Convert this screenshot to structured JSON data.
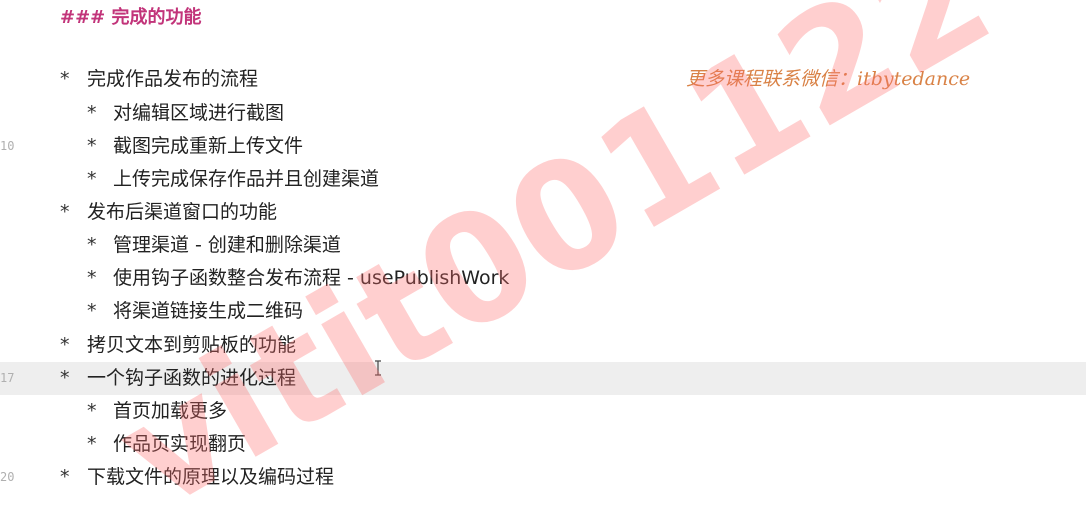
{
  "heading": "### 完成的功能",
  "promo": "更多课程联系微信：itbytedance",
  "watermark": "vitit001122",
  "colors": {
    "heading": "#c2347a",
    "promo": "#d98246",
    "watermark": "#ff6e6e",
    "current_line": "#eeeeee"
  },
  "lines": [
    {
      "bullet": "*",
      "text": "完成作品发布的流程",
      "line_number": ""
    },
    {
      "bullet": "*",
      "text": "对编辑区域进行截图",
      "line_number": ""
    },
    {
      "bullet": "*",
      "text": "截图完成重新上传文件",
      "line_number": "10"
    },
    {
      "bullet": "*",
      "text": "上传完成保存作品并且创建渠道",
      "line_number": ""
    },
    {
      "bullet": "*",
      "text": "发布后渠道窗口的功能",
      "line_number": ""
    },
    {
      "bullet": "*",
      "text": "管理渠道 - 创建和删除渠道",
      "line_number": ""
    },
    {
      "bullet": "*",
      "text": "使用钩子函数整合发布流程 - usePublishWork",
      "line_number": ""
    },
    {
      "bullet": "*",
      "text": "将渠道链接生成二维码",
      "line_number": ""
    },
    {
      "bullet": "*",
      "text": "拷贝文本到剪贴板的功能",
      "line_number": ""
    },
    {
      "bullet": "*",
      "text": "一个钩子函数的进化过程",
      "line_number": "17"
    },
    {
      "bullet": "*",
      "text": "首页加载更多",
      "line_number": ""
    },
    {
      "bullet": "*",
      "text": "作品页实现翻页",
      "line_number": ""
    },
    {
      "bullet": "*",
      "text": "下载文件的原理以及编码过程",
      "line_number": "20"
    }
  ]
}
